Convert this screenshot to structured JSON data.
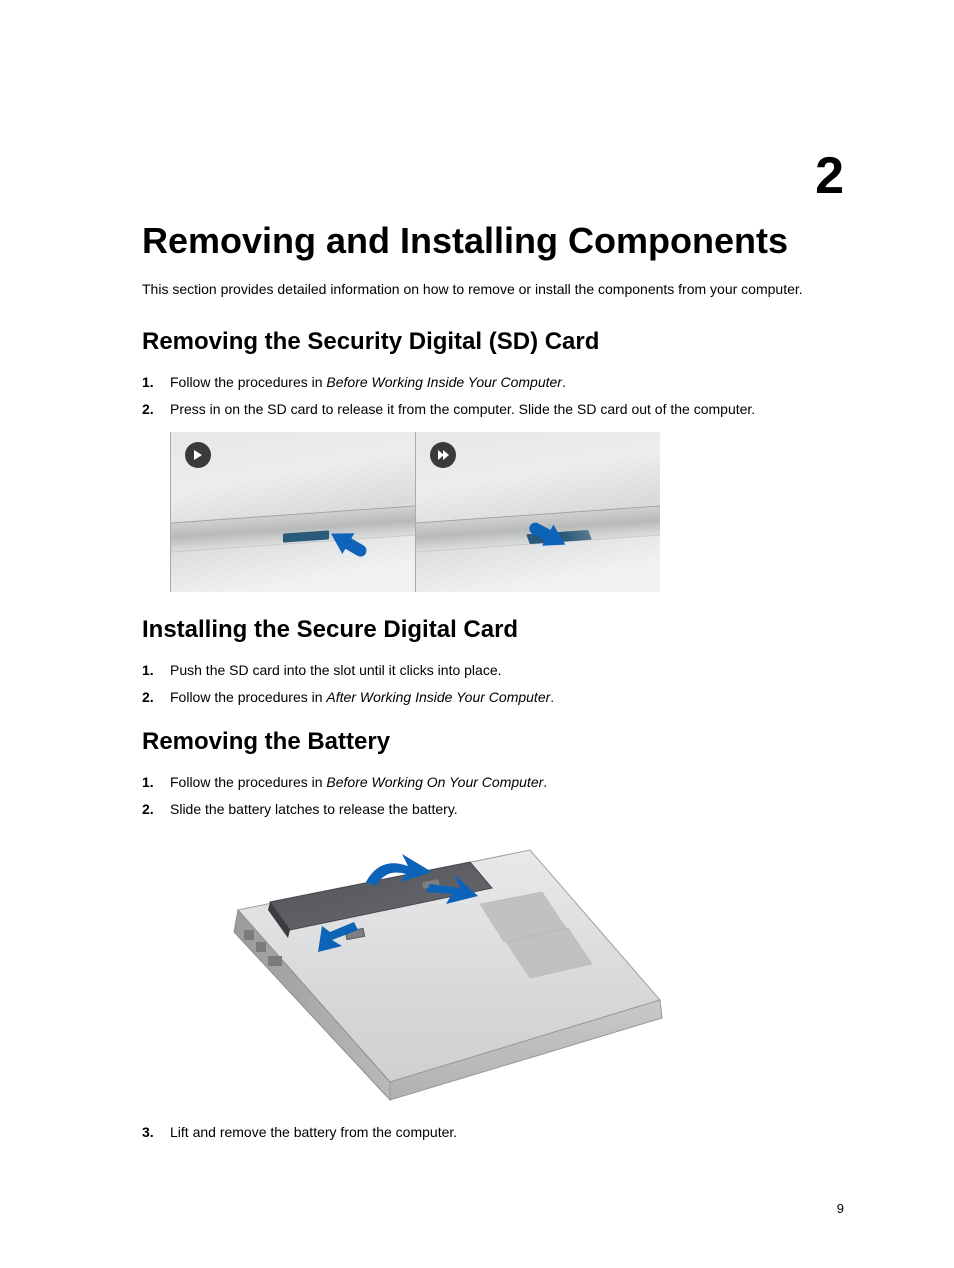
{
  "chapter_number": "2",
  "chapter_title": "Removing and Installing Components",
  "intro": "This section provides detailed information on how to remove or install the components from your computer.",
  "section_a": {
    "title": "Removing the Security Digital (SD) Card",
    "step1_pre": "Follow the procedures in ",
    "step1_ital": "Before Working Inside Your Computer",
    "step1_post": ".",
    "step2": "Press in on the SD card to release it from the computer. Slide the SD card out of the computer."
  },
  "section_b": {
    "title": "Installing the Secure Digital Card",
    "step1": "Push the SD card into the slot until it clicks into place.",
    "step2_pre": "Follow the procedures in ",
    "step2_ital": "After Working Inside Your Computer",
    "step2_post": "."
  },
  "section_c": {
    "title": "Removing the Battery",
    "step1_pre": "Follow the procedures in ",
    "step1_ital": "Before Working On Your Computer",
    "step1_post": ".",
    "step2": "Slide the battery latches to release the battery.",
    "step3": "Lift and remove the battery from the computer."
  },
  "page_number": "9"
}
